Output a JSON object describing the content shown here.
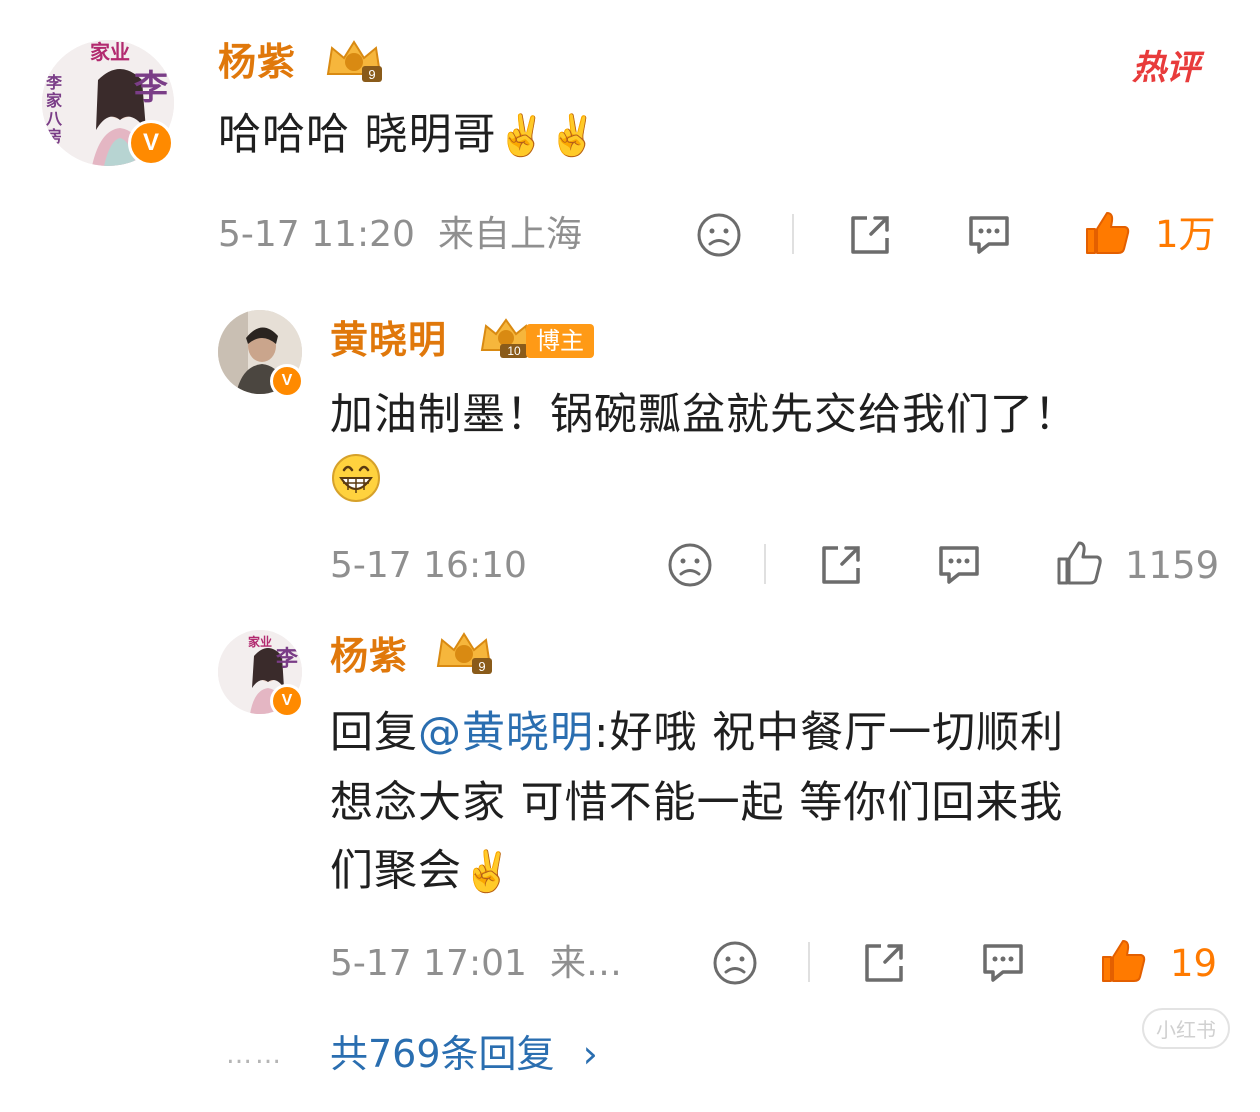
{
  "hot_label": "热评",
  "comments": [
    {
      "user": "杨紫",
      "level": "9",
      "text": "哈哈哈 晓明哥",
      "time": "5-17 11:20",
      "location": "来自上海",
      "likes": "1万"
    },
    {
      "user": "黄晓明",
      "level": "10",
      "tag": "博主",
      "text_line1": "加油制墨！锅碗瓢盆就先交给我们了！",
      "time": "5-17 16:10",
      "likes": "1159"
    },
    {
      "user": "杨紫",
      "level": "9",
      "reply_prefix": "回复",
      "mention": "@黄晓明",
      "text_after_mention": ":好哦 祝中餐厅一切顺利",
      "text_line2": "想念大家 可惜不能一起 等你们回来我",
      "text_line3": "们聚会",
      "time": "5-17 17:01",
      "location": "来…",
      "likes": "19"
    }
  ],
  "avatar_labels": {
    "top": "家业",
    "name": "李",
    "side": "李家八房"
  },
  "more_replies": "共769条回复",
  "dots": "……",
  "watermark": "小红书",
  "colors": {
    "username": "#e0780b",
    "mention": "#2a6eb0",
    "like_active": "#ff7a00",
    "hot": "#e83b3b"
  }
}
